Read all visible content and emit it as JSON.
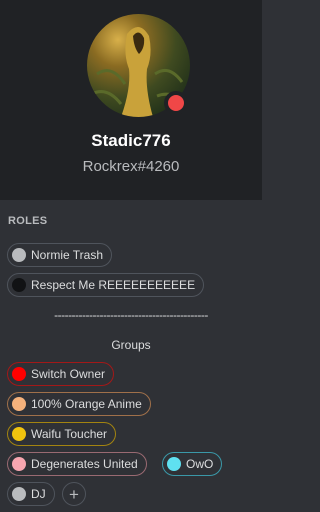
{
  "profile": {
    "username": "Stadic776",
    "tag": "Rockrex#4260",
    "status_color": "#f04747"
  },
  "roles_section": {
    "title": "ROLES"
  },
  "roles": [
    {
      "label": "Normie Trash",
      "color": "#b9bbbe",
      "border": "#4f545c"
    },
    {
      "label": "Respect Me REEEEEEEEEEE",
      "color": "#1a1a1a",
      "border": "#4f545c"
    },
    {
      "label": "--------------------------------------------",
      "type": "divider"
    },
    {
      "label": "Groups",
      "type": "text"
    },
    {
      "label": "Switch Owner",
      "color": "#ff0000",
      "border": "#a31818"
    },
    {
      "label": "100% Orange Anime",
      "color": "#f5b27c",
      "border": "#a0704a"
    },
    {
      "label": "Waifu Toucher",
      "color": "#f1c40f",
      "border": "#a38410"
    },
    {
      "label": "Degenerates United",
      "color": "#f7a6b0",
      "border": "#9a6a72"
    },
    {
      "label": "OwO",
      "color": "#5fe0f0",
      "border": "#3a98a8"
    },
    {
      "label": "DJ",
      "color": "#b9bbbe",
      "border": "#4f545c"
    }
  ],
  "add_role_icon": "plus-icon",
  "add_role_glyph": "+"
}
